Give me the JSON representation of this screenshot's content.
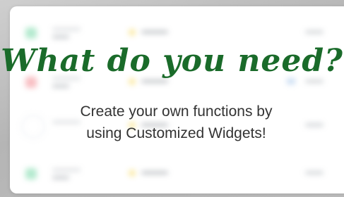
{
  "promo": {
    "headline": "What do you need?",
    "subtext_line1": "Create your own functions by",
    "subtext_line2": "using Customized Widgets!"
  },
  "background_list": {
    "rows": [
      {
        "icon": "green-square",
        "dot": "yellow"
      },
      {
        "icon": "red-square",
        "dot": "yellow"
      },
      {
        "icon": "ring-placeholder",
        "dot": "yellow"
      },
      {
        "icon": "green-square",
        "dot": "yellow"
      }
    ]
  },
  "colors": {
    "headline": "#1a6b2a",
    "green_icon": "#6fd7a3",
    "red_icon": "#f2858d",
    "yellow_dot": "#f6d64f",
    "blue_tag": "#9ec1e8"
  }
}
